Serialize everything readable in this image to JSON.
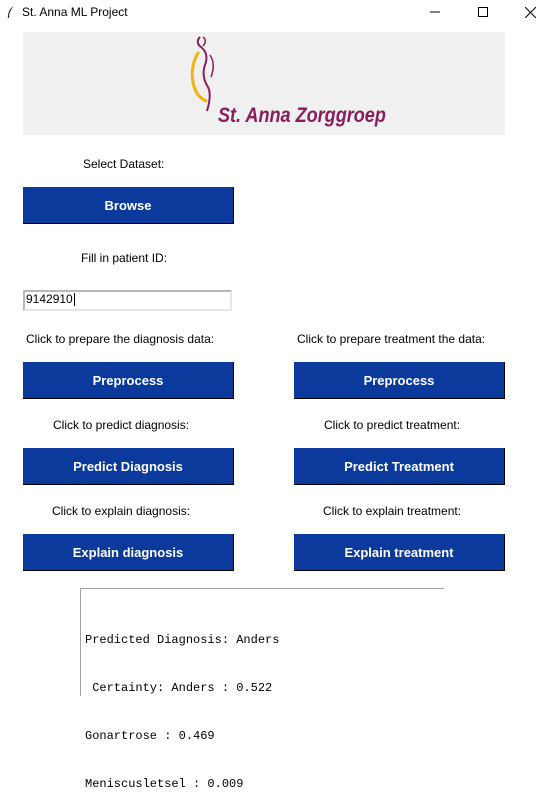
{
  "window": {
    "title": "St. Anna ML Project",
    "icons": [
      "feather-icon",
      "minimize-icon",
      "maximize-icon",
      "close-icon"
    ]
  },
  "banner": {
    "logo_text": "St. Anna Zorggroep",
    "colors": {
      "background": "#f0f0f0",
      "text": "#8a1d5c",
      "figure_gold": "#f1b311"
    }
  },
  "dataset": {
    "label": "Select Dataset:",
    "browse_button": "Browse"
  },
  "patient": {
    "label": "Fill in patient ID:",
    "id_value": "9142910"
  },
  "diagnosis": {
    "prepare_label": "Click to prepare the diagnosis data:",
    "preprocess_button": "Preprocess",
    "predict_label": "Click to predict diagnosis:",
    "predict_button": "Predict Diagnosis",
    "explain_label": "Click to explain diagnosis:",
    "explain_button": "Explain diagnosis"
  },
  "treatment": {
    "prepare_label": "Click to prepare treatment the data:",
    "preprocess_button": "Preprocess",
    "predict_label": "Click to predict treatment:",
    "predict_button": "Predict Treatment",
    "explain_label": "Click to explain treatment:",
    "explain_button": "Explain treatment"
  },
  "output": {
    "lines": [
      "Predicted Diagnosis: Anders",
      " Certainty: Anders : 0.522",
      "Gonartrose : 0.469",
      "Meniscusletsel : 0.009"
    ]
  },
  "colors": {
    "button": "#0b3a9c",
    "button_text": "#ffffff"
  }
}
